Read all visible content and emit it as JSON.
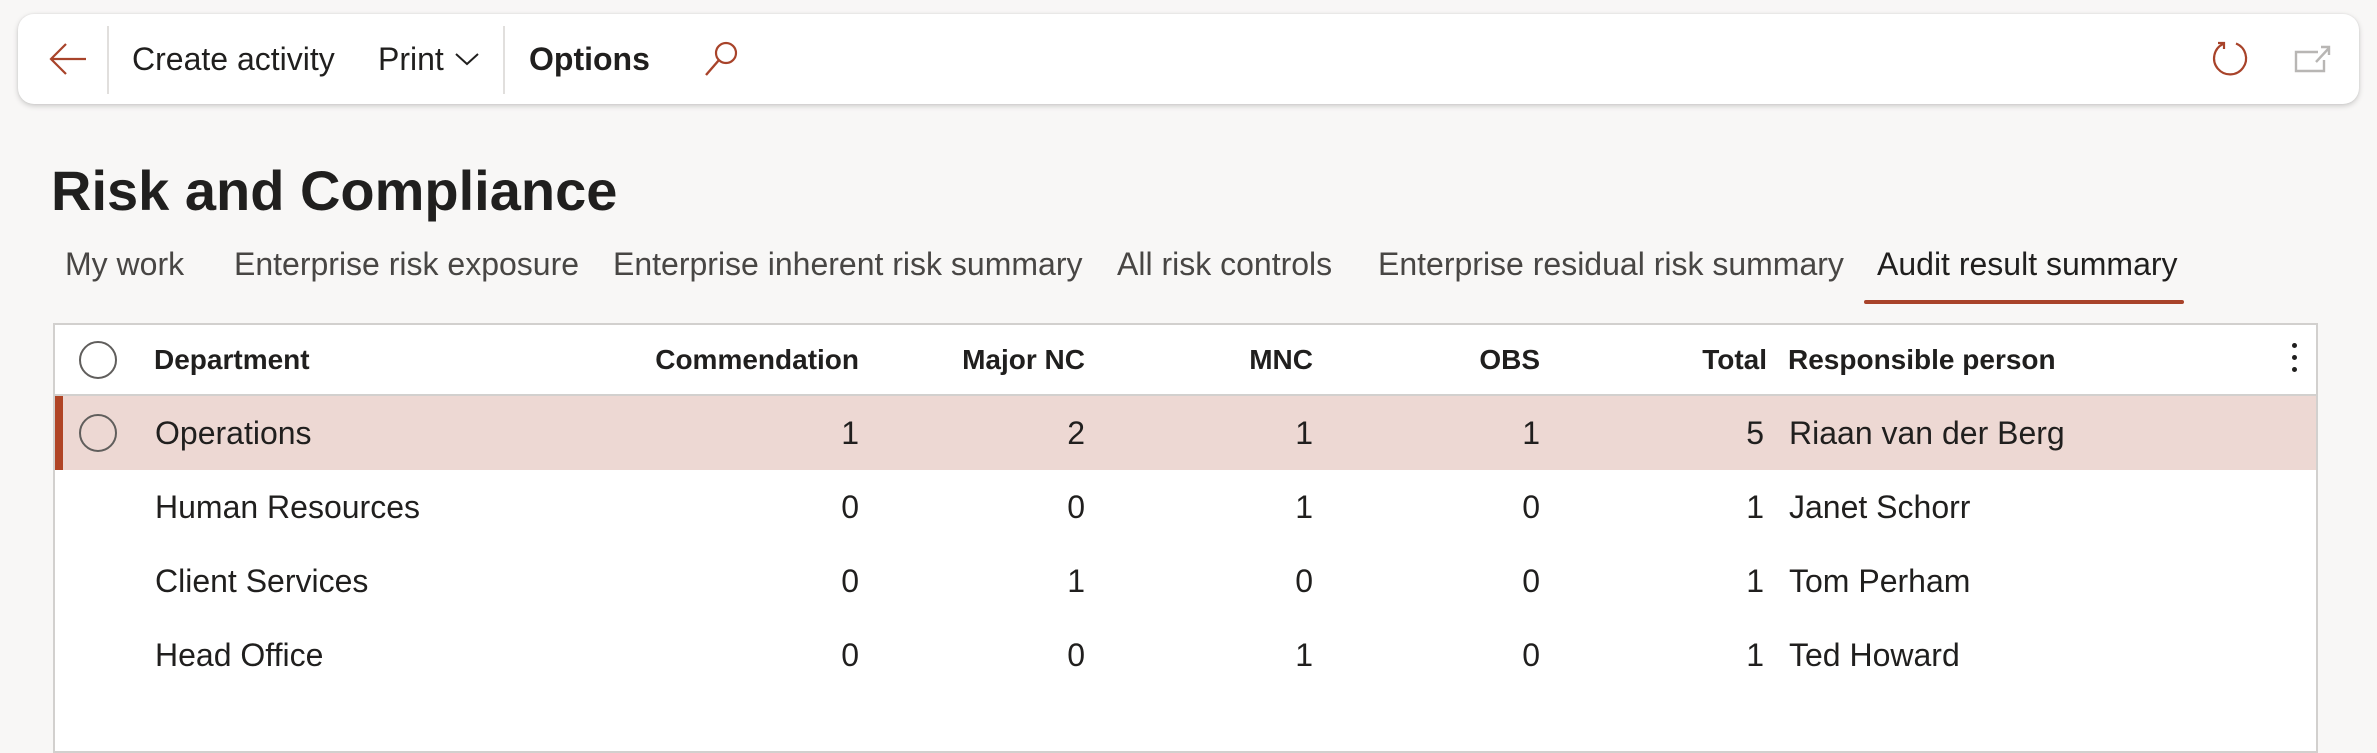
{
  "toolbar": {
    "back_icon": "arrow-left-icon",
    "create_activity_label": "Create activity",
    "print_label": "Print",
    "print_chevron_icon": "chevron-down-icon",
    "options_label": "Options",
    "search_icon": "search-icon",
    "refresh_icon": "refresh-icon",
    "popout_icon": "open-in-new-window-icon"
  },
  "page": {
    "title": "Risk and Compliance"
  },
  "tabs": [
    {
      "label": "My work",
      "active": false
    },
    {
      "label": "Enterprise risk exposure",
      "active": false
    },
    {
      "label": "Enterprise inherent risk summary",
      "active": false
    },
    {
      "label": "All risk controls",
      "active": false
    },
    {
      "label": "Enterprise residual risk summary",
      "active": false
    },
    {
      "label": "Audit result summary",
      "active": true
    }
  ],
  "grid": {
    "columns": [
      "Department",
      "Commendation",
      "Major NC",
      "MNC",
      "OBS",
      "Total",
      "Responsible person"
    ],
    "more_options_icon": "more-vertical-icon",
    "rows": [
      {
        "department": "Operations",
        "commendation": "1",
        "major_nc": "2",
        "mnc": "1",
        "obs": "1",
        "total": "5",
        "responsible": "Riaan van der Berg",
        "selected": true
      },
      {
        "department": "Human Resources",
        "commendation": "0",
        "major_nc": "0",
        "mnc": "1",
        "obs": "0",
        "total": "1",
        "responsible": "Janet Schorr",
        "selected": false
      },
      {
        "department": "Client Services",
        "commendation": "0",
        "major_nc": "1",
        "mnc": "0",
        "obs": "0",
        "total": "1",
        "responsible": "Tom Perham",
        "selected": false
      },
      {
        "department": "Head Office",
        "commendation": "0",
        "major_nc": "0",
        "mnc": "1",
        "obs": "0",
        "total": "1",
        "responsible": "Ted Howard",
        "selected": false
      }
    ]
  },
  "colors": {
    "accent": "#a8432a",
    "selected_row_bg": "#edd8d3",
    "page_bg": "#f8f7f6"
  }
}
